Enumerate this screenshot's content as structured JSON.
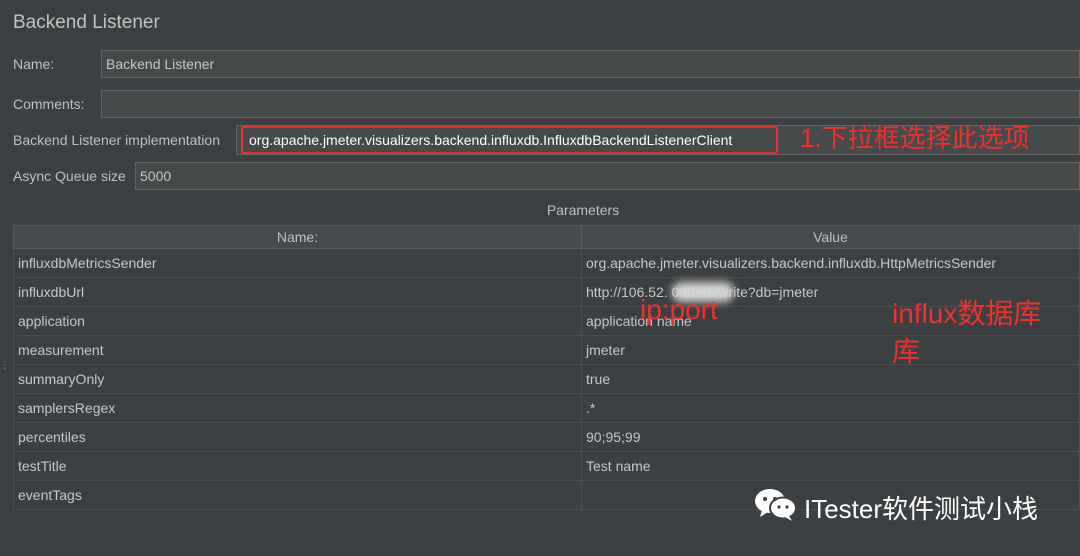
{
  "title": "Backend Listener",
  "form": {
    "name_label": "Name:",
    "name_value": "Backend Listener",
    "comments_label": "Comments:",
    "comments_value": "",
    "impl_label": "Backend Listener implementation",
    "impl_value": "org.apache.jmeter.visualizers.backend.influxdb.InfluxdbBackendListenerClient",
    "queue_label": "Async Queue size",
    "queue_value": "5000"
  },
  "params": {
    "caption": "Parameters",
    "headers": [
      "Name:",
      "Value"
    ],
    "rows": [
      {
        "name": "influxdbMetricsSender",
        "value": "org.apache.jmeter.visualizers.backend.influxdb.HttpMetricsSender"
      },
      {
        "name": "influxdbUrl",
        "value": "http://106.52.                0:8086/write?db=jmeter"
      },
      {
        "name": "application",
        "value": "application name"
      },
      {
        "name": "measurement",
        "value": "jmeter"
      },
      {
        "name": "summaryOnly",
        "value": "true"
      },
      {
        "name": "samplersRegex",
        "value": ".*"
      },
      {
        "name": "percentiles",
        "value": "90;95;99"
      },
      {
        "name": "testTitle",
        "value": "Test name"
      },
      {
        "name": "eventTags",
        "value": ""
      }
    ]
  },
  "annotations": {
    "dropdown_note": "1.下拉框选择此选项",
    "ip_port": "ip:port",
    "influx_db_line1": "influx数据库",
    "influx_db_line2": "库"
  },
  "watermark": {
    "text": "ITester软件测试小栈",
    "icon": "wechat-icon"
  },
  "colors": {
    "background": "#3c3f41",
    "annotation_red": "#e53130",
    "field_bg": "#45494a"
  }
}
